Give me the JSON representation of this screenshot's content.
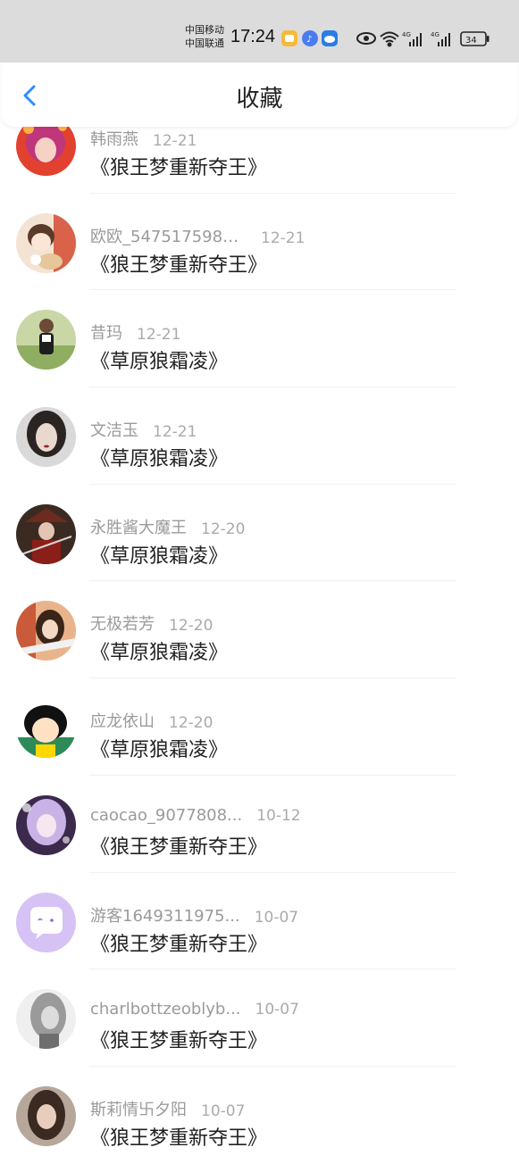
{
  "status_bar": {
    "carrier_1": "中国移动",
    "carrier_2": "中国联通",
    "time": "17:24",
    "net_1": "4G",
    "net_2": "4G",
    "battery": "34",
    "icons": [
      "app-notification-icon",
      "music-app-icon",
      "cloud-app-icon",
      "eye-icon",
      "wifi-icon",
      "signal-icon",
      "signal-icon",
      "battery-icon"
    ]
  },
  "header": {
    "title": "收藏",
    "back_icon": "chevron-left-icon",
    "accent": "#2f8cff"
  },
  "favorites": [
    {
      "name": "韩雨燕",
      "date": "12-21",
      "book": "《狼王梦重新夺王》"
    },
    {
      "name": "欧欧_5475175984...",
      "date": "12-21",
      "book": "《狼王梦重新夺王》"
    },
    {
      "name": "昔玛",
      "date": "12-21",
      "book": "《草原狼霜凌》"
    },
    {
      "name": "文洁玉",
      "date": "12-21",
      "book": "《草原狼霜凌》"
    },
    {
      "name": "永胜酱大魔王",
      "date": "12-20",
      "book": "《草原狼霜凌》"
    },
    {
      "name": "无极若芳",
      "date": "12-20",
      "book": "《草原狼霜凌》"
    },
    {
      "name": "应龙依山",
      "date": "12-20",
      "book": "《草原狼霜凌》"
    },
    {
      "name": "caocao_9077808...",
      "date": "10-12",
      "book": "《狼王梦重新夺王》"
    },
    {
      "name": "游客1649311975...",
      "date": "10-07",
      "book": "《狼王梦重新夺王》"
    },
    {
      "name": "charlbottzeoblyb...",
      "date": "10-07",
      "book": "《狼王梦重新夺王》"
    },
    {
      "name": "斯莉情卐夕阳",
      "date": "10-07",
      "book": "《狼王梦重新夺王》"
    }
  ]
}
